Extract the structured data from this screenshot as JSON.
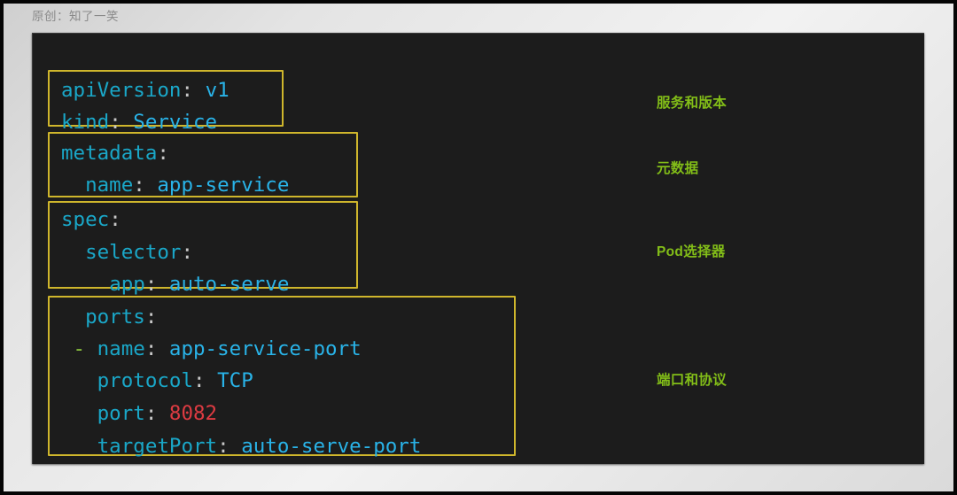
{
  "header": {
    "credit": "原创：知了一笑"
  },
  "colors": {
    "panel_background": "#1c1c1c",
    "group_border": "#cfb62c",
    "yaml_key": "#1aa7c8",
    "yaml_value": "#29b3e8",
    "punctuation": "#c8c8c8",
    "list_dash": "#8dc53e",
    "number": "#dd3b42",
    "annotation": "#82bd18",
    "page_background": "#e4e4e4"
  },
  "code": {
    "language": "yaml",
    "lines": [
      {
        "indent": 0,
        "key": "apiVersion",
        "colon": ":",
        "value": "v1",
        "value_type": "string"
      },
      {
        "indent": 0,
        "key": "kind",
        "colon": ":",
        "value": "Service",
        "value_type": "string"
      },
      {
        "indent": 0,
        "key": "metadata",
        "colon": ":",
        "value": "",
        "value_type": "none"
      },
      {
        "indent": 2,
        "key": "name",
        "colon": ":",
        "value": "app-service",
        "value_type": "string"
      },
      {
        "indent": 0,
        "key": "spec",
        "colon": ":",
        "value": "",
        "value_type": "none"
      },
      {
        "indent": 2,
        "key": "selector",
        "colon": ":",
        "value": "",
        "value_type": "none"
      },
      {
        "indent": 4,
        "key": "app",
        "colon": ":",
        "value": "auto-serve",
        "value_type": "string"
      },
      {
        "indent": 2,
        "key": "ports",
        "colon": ":",
        "value": "",
        "value_type": "none"
      },
      {
        "indent": 1,
        "dash": "-",
        "key": "name",
        "colon": ":",
        "value": "app-service-port",
        "value_type": "string"
      },
      {
        "indent": 3,
        "key": "protocol",
        "colon": ":",
        "value": "TCP",
        "value_type": "string"
      },
      {
        "indent": 3,
        "key": "port",
        "colon": ":",
        "value": "8082",
        "value_type": "number"
      },
      {
        "indent": 3,
        "key": "targetPort",
        "colon": ":",
        "value": "auto-serve-port",
        "value_type": "string"
      }
    ],
    "rendered": [
      "apiVersion: v1",
      "kind: Service",
      "metadata:",
      "  name: app-service",
      "spec:",
      "  selector:",
      "    app: auto-serve",
      "  ports:",
      "  - name: app-service-port",
      "    protocol: TCP",
      "    port: 8082",
      "    targetPort: auto-serve-port"
    ],
    "groups": [
      {
        "id": "group-0",
        "label": "服务和版本",
        "lines": [
          0,
          1
        ]
      },
      {
        "id": "group-1",
        "label": "元数据",
        "lines": [
          2,
          3
        ]
      },
      {
        "id": "group-2",
        "label": "Pod选择器",
        "lines": [
          4,
          5,
          6
        ]
      },
      {
        "id": "group-3",
        "label": "端口和协议",
        "lines": [
          7,
          8,
          9,
          10,
          11
        ]
      }
    ]
  },
  "annotations": [
    {
      "text": "服务和版本"
    },
    {
      "text": "元数据"
    },
    {
      "text": "Pod选择器"
    },
    {
      "text": "端口和协议"
    }
  ]
}
